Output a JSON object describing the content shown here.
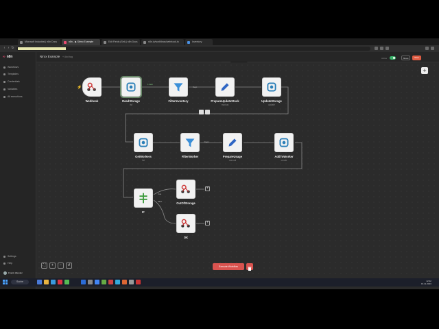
{
  "browser": {
    "tabs": [
      {
        "label": "Microsoft Industrial | n8n Docs",
        "active": false
      },
      {
        "label": "n8n - ▶ Stimo Example",
        "active": true
      },
      {
        "label": "Edit Fields (Set) | n8n Docs",
        "active": false
      },
      {
        "label": "n8n.io/workflows/webhook-to",
        "active": false
      },
      {
        "label": "Inventory",
        "active": false
      }
    ]
  },
  "app": {
    "brand": "n8n",
    "workflow_name": "Nirox Example",
    "add_tag": "+ Add tag",
    "view_tabs": [
      {
        "label": "Editor",
        "active": true
      },
      {
        "label": "Executions",
        "active": false
      }
    ],
    "active_label": "Active",
    "share_label": "Share",
    "save_label": "Save",
    "accent": "#ea4b71"
  },
  "sidebar": {
    "items": [
      {
        "label": "Workflows",
        "icon": "workflow-icon"
      },
      {
        "label": "Templates",
        "icon": "templates-icon"
      },
      {
        "label": "Credentials",
        "icon": "key-icon"
      },
      {
        "label": "Variables",
        "icon": "variables-icon"
      },
      {
        "label": "All executions",
        "icon": "list-icon"
      }
    ],
    "bottom": [
      {
        "label": "Settings",
        "icon": "gear-icon"
      },
      {
        "label": "Help",
        "icon": "help-icon"
      }
    ],
    "user": "Frank Wexler"
  },
  "nodes": {
    "webhook": {
      "label": "Webhook",
      "sub": "",
      "icon": "webhook-icon"
    },
    "readstorage": {
      "label": "ReadStorage",
      "sub": "list",
      "icon": "database-icon"
    },
    "filterinventory": {
      "label": "FilterInventory",
      "sub": "",
      "icon": "filter-icon"
    },
    "prepareupdatestock": {
      "label": "PrepareUpdateStock",
      "sub": "manual",
      "icon": "pencil-icon"
    },
    "updatestorage": {
      "label": "UpdateStorage",
      "sub": "update",
      "icon": "database-icon"
    },
    "getworkers": {
      "label": "GetWorkers",
      "sub": "list",
      "icon": "database-icon"
    },
    "filterworker": {
      "label": "FilterWorker",
      "sub": "",
      "icon": "filter-icon"
    },
    "prepareusage": {
      "label": "PrepareUsage",
      "sub": "manual",
      "icon": "pencil-icon"
    },
    "addtoworker": {
      "label": "AddToWorker",
      "sub": "create",
      "icon": "database-icon"
    },
    "if": {
      "label": "IF",
      "sub": "",
      "icon": "if-icon"
    },
    "outofstorage": {
      "label": "OutOfStorage",
      "sub": "",
      "icon": "webhook-icon"
    },
    "ok": {
      "label": "OK",
      "sub": "",
      "icon": "webhook-icon"
    }
  },
  "edges": {
    "items_label": "1 item",
    "kept_label": "Kept",
    "true_label": "true",
    "false_label": "false"
  },
  "canvas_controls": {
    "execute_label": "Execute Workflow"
  },
  "taskbar": {
    "search_label": "Suche",
    "time": "12:22",
    "date": "16.11.2023"
  }
}
